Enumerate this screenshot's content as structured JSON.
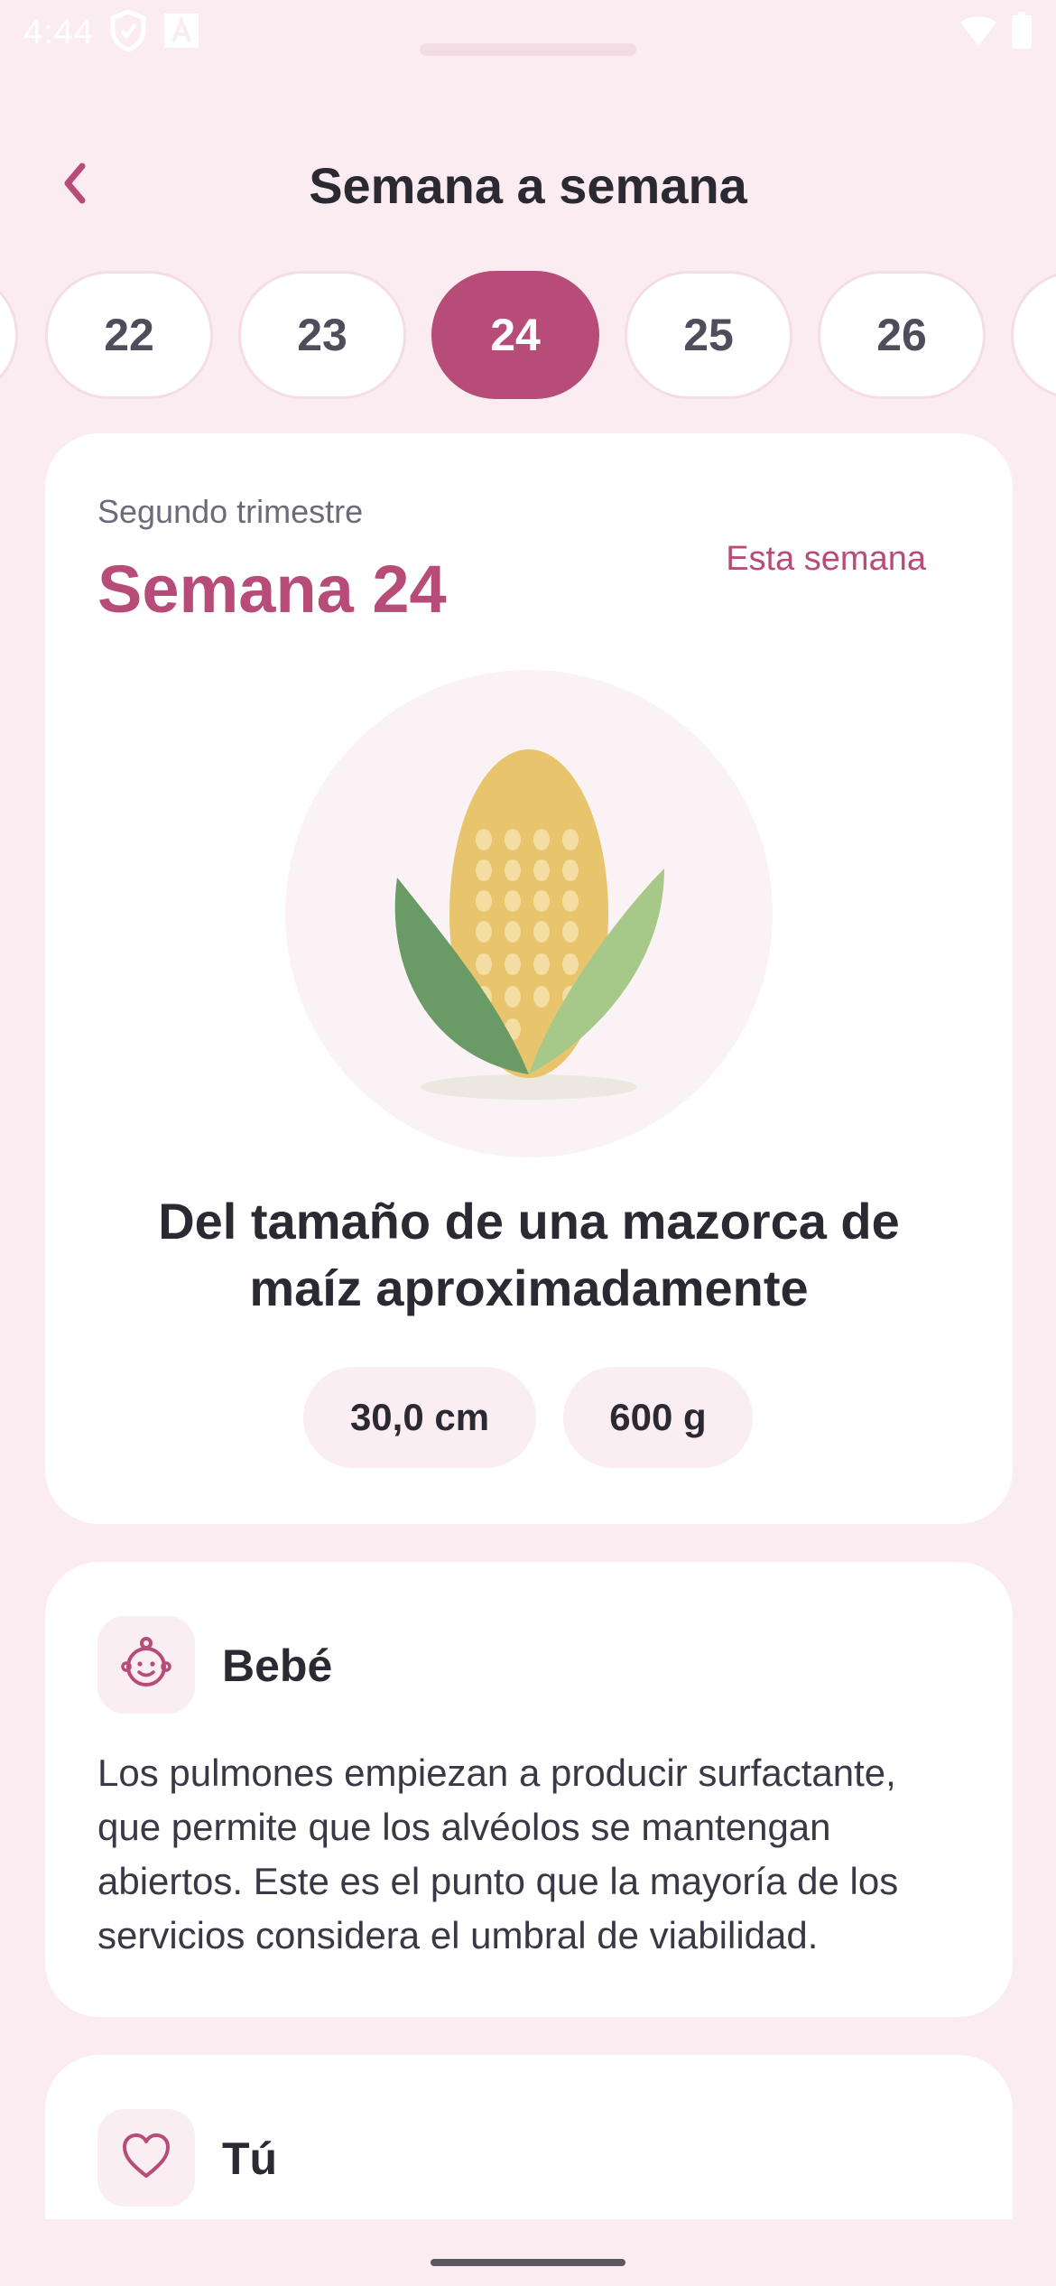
{
  "status_bar": {
    "time": "4:44",
    "icons": [
      "shield-icon",
      "font-a-icon",
      "wifi-icon",
      "battery-icon"
    ]
  },
  "header": {
    "back_icon": "chevron-left-icon",
    "title": "Semana a semana"
  },
  "weeks": {
    "items": [
      "22",
      "23",
      "24",
      "25",
      "26"
    ],
    "selected": "24"
  },
  "week_card": {
    "trimester": "Segundo trimestre",
    "title": "Semana 24",
    "this_week_link": "Esta semana",
    "fruit_icon": "corn-icon",
    "size_text": "Del tamaño de una mazorca de maíz aproximadamente",
    "length": "30,0 cm",
    "weight": "600 g"
  },
  "baby": {
    "icon": "baby-face-icon",
    "title": "Bebé",
    "text": "Los pulmones empiezan a producir surfactante, que permite que los alvéolos se mantengan abiertos. Este es el punto que la mayoría de los servicios considera el umbral de viabilidad."
  },
  "you": {
    "icon": "heart-icon",
    "title": "Tú"
  },
  "colors": {
    "background": "#fbecf1",
    "accent": "#b84c78",
    "card": "#ffffff",
    "chip": "#faeef2"
  }
}
